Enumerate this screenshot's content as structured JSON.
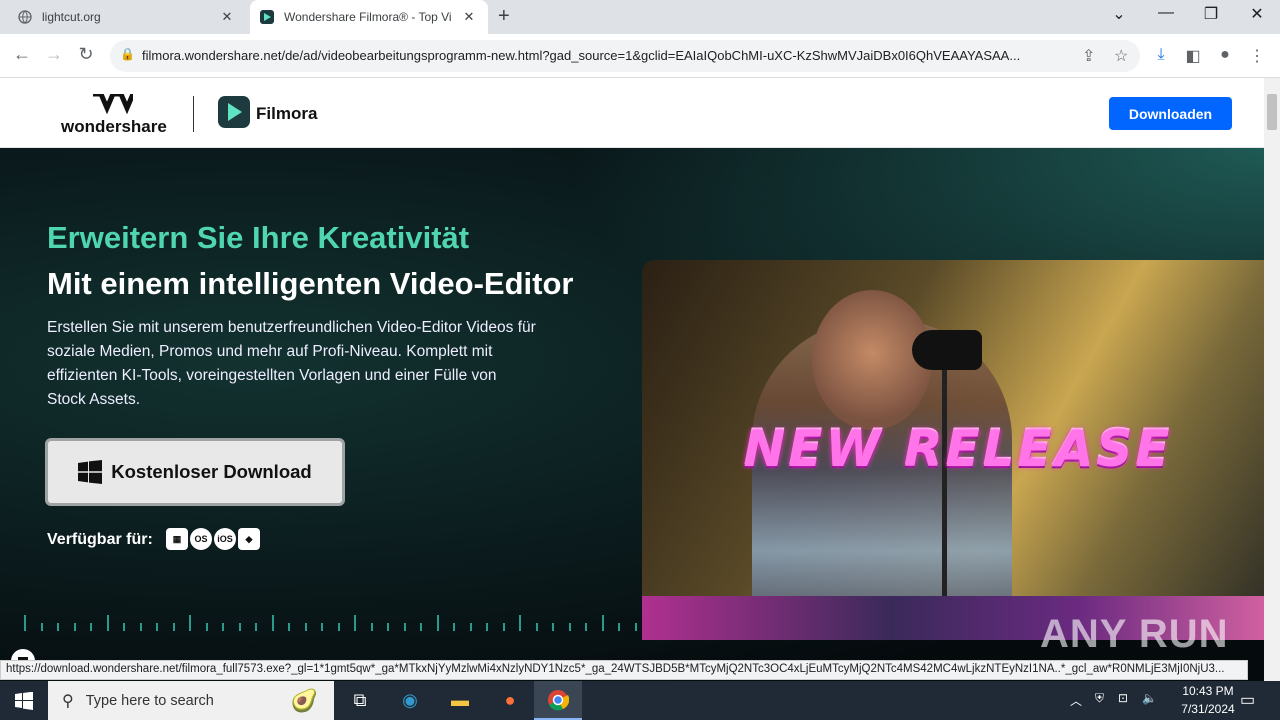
{
  "browser": {
    "tabs": [
      {
        "title": "lightcut.org",
        "active": false
      },
      {
        "title": "Wondershare Filmora® - Top Vi",
        "active": true
      }
    ],
    "url": "filmora.wondershare.net/de/ad/videobearbeitungsprogramm-new.html?gad_source=1&gclid=EAIaIQobChMI-uXC-KzShwMVJaiDBx0I6QhVEAAYASAA...",
    "status_url": "https://download.wondershare.net/filmora_full7573.exe?_gl=1*1gmt5qw*_ga*MTkxNjYyMzlwMi4xNzlyNDY1Nzc5*_ga_24WTSJBD5B*MTcyMjQ2NTc3OC4xLjEuMTcyMjQ2NTc4MS42MC4wLjkzNTEyNzI1NA..*_gcl_aw*R0NMLjE3MjI0NjU3..."
  },
  "site": {
    "brand_name": "wondershare",
    "product_name": "Filmora",
    "header_button": "Downloaden",
    "hero_title_1": "Erweitern Sie Ihre Kreativität",
    "hero_title_2": "Mit einem intelligenten Video-Editor",
    "hero_description": "Erstellen Sie mit unserem benutzerfreundlichen Video-Editor Videos für soziale Medien, Promos und mehr auf Profi-Niveau. Komplett mit effizienten KI-Tools, voreingestellten Vorlagen und einer Fülle von Stock Assets.",
    "download_button": "Kostenloser Download",
    "available_label": "Verfügbar für:",
    "platforms": [
      "windows-icon",
      "macos-icon",
      "ios-icon",
      "android-icon"
    ],
    "video_overlay": "NEW RELEASE",
    "accent_color": "#0066ff",
    "title_color": "#4fd6b0"
  },
  "watermark": "ANY RUN",
  "taskbar": {
    "search_placeholder": "Type here to search",
    "time": "10:43 PM",
    "date": "7/31/2024"
  }
}
